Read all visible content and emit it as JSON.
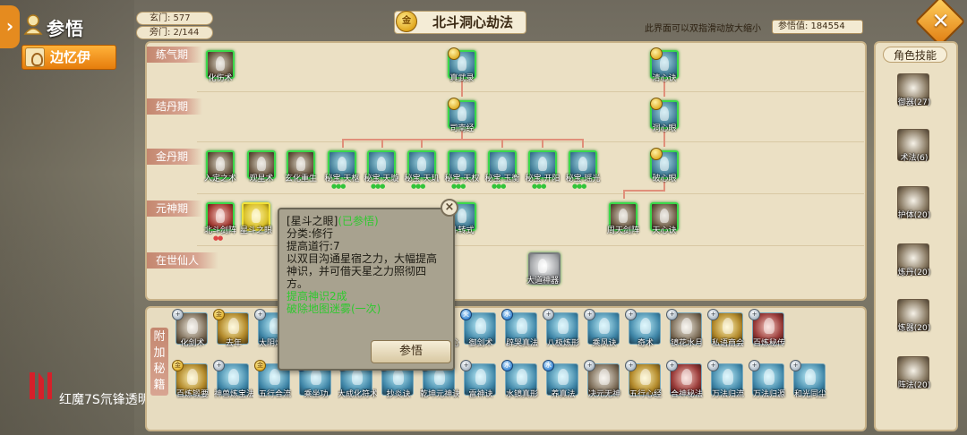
{
  "header": {
    "page_title": "参悟",
    "character_name": "边忆伊",
    "xuanmen_label": "玄门: 577",
    "pangmen_label": "旁门: 2/144",
    "tree_title": "北斗洞心劫法",
    "gold_icon_text": "金",
    "hint": "此界面可以双指滑动放大缩小",
    "insight_value": "参悟值: 184554"
  },
  "realms": [
    "练气期",
    "结丹期",
    "金丹期",
    "元神期",
    "在世仙人"
  ],
  "tree_nodes": [
    {
      "label": "化伤术"
    },
    {
      "label": "真武录"
    },
    {
      "label": "清心诀"
    },
    {
      "label": "司南经"
    },
    {
      "label": "洞心眼"
    },
    {
      "label": "入定之术"
    },
    {
      "label": "观星术"
    },
    {
      "label": "玄化重生"
    },
    {
      "label": "秘宝·天枢"
    },
    {
      "label": "秘宝·天璇"
    },
    {
      "label": "秘宝·天玑"
    },
    {
      "label": "秘宝·天权"
    },
    {
      "label": "秘宝·玉衡"
    },
    {
      "label": "秘宝·开阳"
    },
    {
      "label": "秘宝·瑶光"
    },
    {
      "label": "破心眼"
    },
    {
      "label": "北斗剑阵"
    },
    {
      "label": "星斗之眼"
    },
    {
      "label": "斗转式"
    },
    {
      "label": "周天剑阵"
    },
    {
      "label": "天心诀"
    },
    {
      "label": "大道神器"
    }
  ],
  "tooltip": {
    "title": "[星斗之眼]",
    "status": "(已参悟)",
    "category": "分类:修行",
    "stat": "提高道行:7",
    "desc": "以双目沟通星宿之力，大幅提高神识，并可借天星之力照彻四方。",
    "effect1": "提高神识2成",
    "effect2": "破除地图迷雾(一次)",
    "button": "参悟",
    "close": "×"
  },
  "extra_section_label": "附加秘籍",
  "extra_row1": [
    {
      "label": "化剑术",
      "badge": "+",
      "type": "dark"
    },
    {
      "label": "去年",
      "badge": "金",
      "type": "gold"
    },
    {
      "label": "太阴炼体",
      "badge": "+",
      "type": "blue"
    },
    {
      "label": "地煞",
      "badge": "+",
      "type": "blue"
    },
    {
      "label": "无相",
      "badge": "+",
      "type": "blue"
    },
    {
      "label": "五鬼",
      "badge": "水",
      "type": "blue"
    },
    {
      "label": "五鬼搬运心法",
      "badge": "水",
      "type": "blue"
    },
    {
      "label": "御剑术",
      "badge": "火",
      "type": "blue"
    },
    {
      "label": "辟哭真法",
      "badge": "水",
      "type": "blue"
    },
    {
      "label": "八极炼形",
      "badge": "+",
      "type": "blue"
    },
    {
      "label": "乘风诀",
      "badge": "+",
      "type": "blue"
    },
    {
      "label": "奇术",
      "badge": "+",
      "type": "blue"
    },
    {
      "label": "镜花水月",
      "badge": "+",
      "type": "dark"
    },
    {
      "label": "私语商会",
      "badge": "+",
      "type": "gold"
    },
    {
      "label": "百炼秘传",
      "badge": "+",
      "type": "red"
    }
  ],
  "extra_row2": [
    {
      "label": "百炼锻要",
      "badge": "金",
      "type": "gold"
    },
    {
      "label": "神兽炼宝法",
      "badge": "+",
      "type": "blue"
    },
    {
      "label": "五行合流",
      "badge": "金",
      "type": "blue"
    },
    {
      "label": "乘坐功",
      "badge": "水",
      "type": "blue"
    },
    {
      "label": "大成化符术",
      "badge": "+",
      "type": "blue"
    },
    {
      "label": "抄炎诀",
      "badge": "+",
      "type": "blue"
    },
    {
      "label": "乾坤元神诀",
      "badge": "+",
      "type": "blue"
    },
    {
      "label": "雷神诀",
      "badge": "+",
      "type": "blue"
    },
    {
      "label": "水镜真形",
      "badge": "水",
      "type": "blue"
    },
    {
      "label": "养真法",
      "badge": "水",
      "type": "blue"
    },
    {
      "label": "决元无神",
      "badge": "+",
      "type": "dark"
    },
    {
      "label": "五行心经",
      "badge": "+",
      "type": "gold"
    },
    {
      "label": "合神秘法",
      "badge": "+",
      "type": "red"
    },
    {
      "label": "万法归流",
      "badge": "+",
      "type": "blue"
    },
    {
      "label": "万法归源",
      "badge": "+",
      "type": "blue"
    },
    {
      "label": "和光同尘",
      "badge": "+",
      "type": "blue"
    }
  ],
  "right_panel": {
    "title": "角色技能",
    "skills": [
      {
        "label": "御器(27)"
      },
      {
        "label": "术法(6)"
      },
      {
        "label": "护体(20)"
      },
      {
        "label": "炼丹(20)"
      },
      {
        "label": "炼器(20)"
      },
      {
        "label": "阵法(20)"
      }
    ]
  },
  "watermark": "红魔7S氘锋透明版",
  "colors": {
    "accent_orange": "#e58b1f",
    "node_border_green": "#3bd94a",
    "edge_color": "#e08f7a",
    "panel_bg": "#ebe0c4"
  }
}
